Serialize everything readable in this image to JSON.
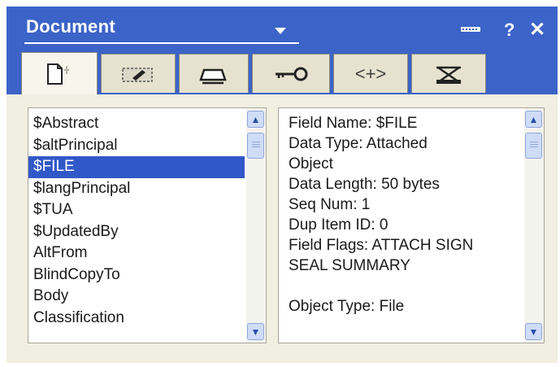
{
  "window": {
    "title": "Document",
    "help_label": "?",
    "close_label": "✕"
  },
  "tabs": [
    {
      "icon": "document-icon",
      "active": true
    },
    {
      "icon": "pen-icon",
      "active": false
    },
    {
      "icon": "printer-icon",
      "active": false
    },
    {
      "icon": "key-icon",
      "active": false
    },
    {
      "icon": "code-brackets-icon",
      "label": "<+>",
      "active": false
    },
    {
      "icon": "network-icon",
      "active": false
    }
  ],
  "field_list": {
    "items": [
      "$Abstract",
      "$altPrincipal",
      "$FILE",
      "$langPrincipal",
      "$TUA",
      "$UpdatedBy",
      "AltFrom",
      "BlindCopyTo",
      "Body",
      "Classification"
    ],
    "selected": "$FILE"
  },
  "field_details": {
    "lines": [
      "Field Name: $FILE",
      "Data Type: Attached",
      "Object",
      "Data Length: 50 bytes",
      "Seq Num: 1",
      "Dup Item ID: 0",
      "Field Flags: ATTACH SIGN",
      "SEAL SUMMARY",
      "",
      "Object Type: File"
    ]
  },
  "colors": {
    "titlebar": "#3b63c8",
    "selection": "#3158c8",
    "background": "#f1eee2"
  }
}
